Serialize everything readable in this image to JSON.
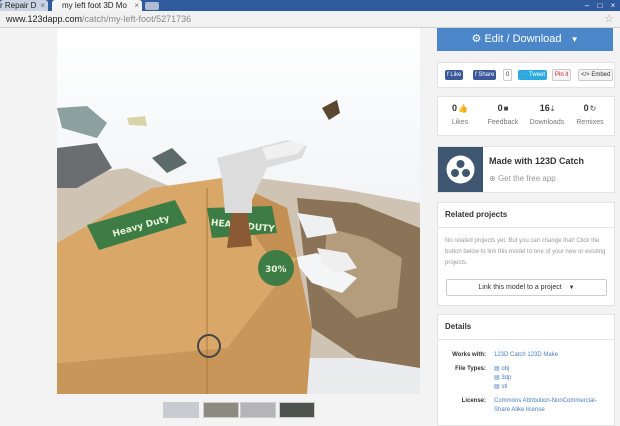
{
  "browser": {
    "tabs": [
      {
        "label": "r Repair D"
      },
      {
        "label": "my left foot 3D Mo"
      }
    ],
    "url_host": "www.123dapp.com",
    "url_path": "/catch/my-left-foot/5271736"
  },
  "sidebar": {
    "edit_label": "Edit / Download",
    "share": {
      "like": "Like",
      "share": "Share",
      "share_count": "0",
      "tweet": "Tweet",
      "pinit": "Pin it",
      "embed": "Embed"
    },
    "stats": [
      {
        "value": "0",
        "label": "Likes",
        "icon": "thumbs-up-icon",
        "glyph": "👍"
      },
      {
        "value": "0",
        "label": "Feedback",
        "icon": "comment-icon",
        "glyph": "■"
      },
      {
        "value": "16",
        "label": "Downloads",
        "icon": "download-icon",
        "glyph": "⤓"
      },
      {
        "value": "0",
        "label": "Remixes",
        "icon": "remix-icon",
        "glyph": "↻"
      }
    ],
    "made_with": {
      "title": "Made with 123D Catch",
      "get_app": "Get the free app"
    },
    "related": {
      "title": "Related projects",
      "description": "No related projects yet. But you can change that! Click the button below to link this model to one of your new or existing projects.",
      "link_button": "Link this model to a project"
    },
    "details": {
      "title": "Details",
      "works_with_label": "Works with:",
      "works_with": "123D Catch  123D Make",
      "file_types_label": "File Types:",
      "file_types": [
        "obj",
        "3dp",
        "stl"
      ],
      "license_label": "License:",
      "license": "Commons Attribution-NonCommercial-Share Alike license"
    }
  },
  "viewer": {
    "box_text_1": "Heavy Duty",
    "box_text_2": "HEAVY DUTY",
    "box_badge": "30%"
  },
  "colors": {
    "accent": "#4a86c8",
    "tabbar": "#2f5a9e",
    "catch_logo": "#3e5670"
  }
}
